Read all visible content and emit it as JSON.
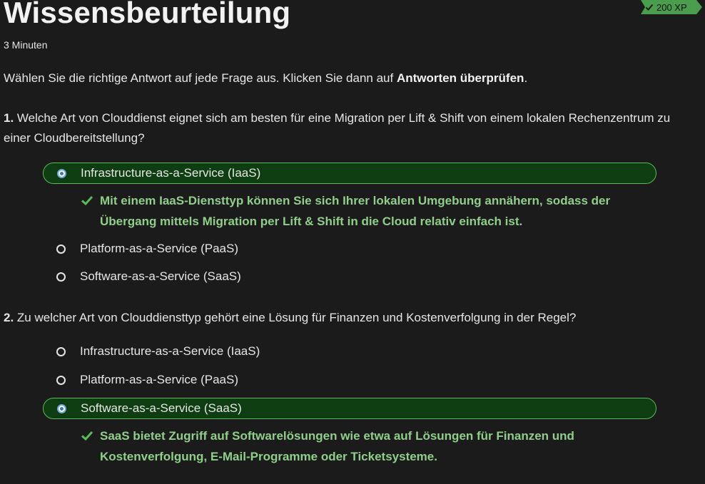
{
  "header": {
    "title": "Wissensbeurteilung",
    "duration": "3 Minuten",
    "xp": "200 XP"
  },
  "instructions": {
    "text": "Wählen Sie die richtige Antwort auf jede Frage aus. Klicken Sie dann auf ",
    "bold": "Antworten überprüfen",
    "end": "."
  },
  "questions": [
    {
      "number": "1.",
      "text": " Welche Art von Clouddienst eignet sich am besten für eine Migration per Lift & Shift von einem lokalen Rechenzentrum zu einer Cloudbereitstellung?",
      "options": [
        {
          "label": "Infrastructure-as-a-Service (IaaS)",
          "selected": true
        },
        {
          "label": "Platform-as-a-Service (PaaS)",
          "selected": false
        },
        {
          "label": "Software-as-a-Service (SaaS)",
          "selected": false
        }
      ],
      "feedback": "Mit einem IaaS-Diensttyp können Sie sich Ihrer lokalen Umgebung annähern, sodass der Übergang mittels Migration per Lift & Shift in die Cloud relativ einfach ist."
    },
    {
      "number": "2.",
      "text": " Zu welcher Art von Clouddiensttyp gehört eine Lösung für Finanzen und Kostenverfolgung in der Regel?",
      "options": [
        {
          "label": "Infrastructure-as-a-Service (IaaS)",
          "selected": false
        },
        {
          "label": "Platform-as-a-Service (PaaS)",
          "selected": false
        },
        {
          "label": "Software-as-a-Service (SaaS)",
          "selected": true
        }
      ],
      "feedback": "SaaS bietet Zugriff auf Softwarelösungen wie etwa auf Lösungen für Finanzen und Kostenverfolgung, E-Mail-Programme oder Ticketsysteme."
    }
  ],
  "colors": {
    "background": "#1b1b1b",
    "selected_fill": "#0e3d12",
    "selected_border": "#5cb85c",
    "feedback_text": "#8fcf8a",
    "xp_badge": "#4a9d4c"
  }
}
